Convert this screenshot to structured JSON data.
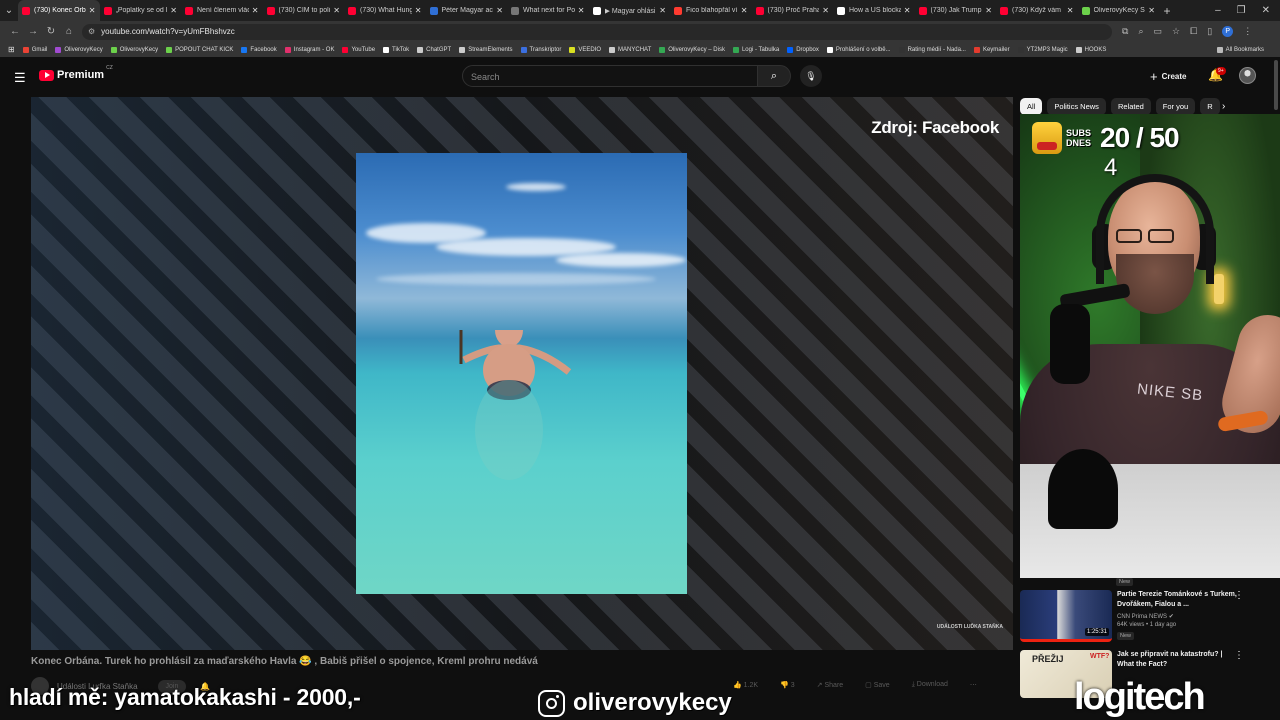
{
  "browser": {
    "tabs": [
      {
        "label": "(730) Konec Orbá",
        "color": "#ff0033",
        "active": true
      },
      {
        "label": "„Poplatky se od le",
        "color": "#ff0033",
        "active": false
      },
      {
        "label": "Není členem vlád",
        "color": "#ff0033",
        "active": false
      },
      {
        "label": "(730) ČÍM to poli",
        "color": "#ff0033",
        "active": false
      },
      {
        "label": "(730) What Hung",
        "color": "#ff0033",
        "active": false
      },
      {
        "label": "Péter Magyar ac",
        "color": "#2f6fd6",
        "active": false
      },
      {
        "label": "What next for Po",
        "color": "#777777",
        "active": false
      },
      {
        "label": "▶ Magyar ohlási",
        "color": "#ffffff",
        "active": false
      },
      {
        "label": "Fico blahopřál ví",
        "color": "#ff3b30",
        "active": false
      },
      {
        "label": "(730) Proč Praha",
        "color": "#ff0033",
        "active": false
      },
      {
        "label": "How a US blocka",
        "color": "#ffffff",
        "active": false
      },
      {
        "label": "(730) Jak Trump",
        "color": "#ff0033",
        "active": false
      },
      {
        "label": "(730) Když vám",
        "color": "#ff0033",
        "active": false
      },
      {
        "label": "OliverovyKecy St",
        "color": "#6cd14b",
        "active": false
      }
    ],
    "url": "youtube.com/watch?v=yUmFBhshvzc",
    "bookmarks": [
      {
        "label": "Gmail",
        "color": "#ea4335"
      },
      {
        "label": "OliverovyKecy",
        "color": "#a14bd1"
      },
      {
        "label": "OliverovyKecy",
        "color": "#6cd14b"
      },
      {
        "label": "POPOUT CHAT KICK",
        "color": "#6cd14b"
      },
      {
        "label": "Facebook",
        "color": "#1877f2"
      },
      {
        "label": "Instagram - OK",
        "color": "#e1306c"
      },
      {
        "label": "YouTube",
        "color": "#ff0033"
      },
      {
        "label": "TikTok",
        "color": "#ffffff"
      },
      {
        "label": "ChatGPT",
        "color": "#cccccc"
      },
      {
        "label": "StreamElements",
        "color": "#cccccc"
      },
      {
        "label": "Transkriptor",
        "color": "#3b6fe0"
      },
      {
        "label": "VEEDIO",
        "color": "#d9e021"
      },
      {
        "label": "MANYCHAT",
        "color": "#cccccc"
      },
      {
        "label": "OliverovyKecy – Disk",
        "color": "#34a853"
      },
      {
        "label": "Logi - Tabulka",
        "color": "#34a853"
      },
      {
        "label": "Dropbox",
        "color": "#0061ff"
      },
      {
        "label": "Prohlášení o volbě...",
        "color": "#ffffff"
      },
      {
        "label": "Rating médií - Nada...",
        "color": "#333333"
      },
      {
        "label": "Keymailer",
        "color": "#e33b2e"
      },
      {
        "label": "YT2MP3 Magic",
        "color": "#333333"
      },
      {
        "label": "HOOKS",
        "color": "#cccccc"
      }
    ],
    "all_bookmarks": "All Bookmarks"
  },
  "youtube": {
    "logo_text": "Premium",
    "country": "CZ",
    "search_placeholder": "Search",
    "create_label": "Create",
    "notif_count": "9+",
    "chips": [
      "All",
      "Politics News",
      "Related",
      "For you",
      "R"
    ]
  },
  "video": {
    "source_label": "Zdroj: Facebook",
    "watermark": "UDÁLOSTI LUĎKA STAŇKA",
    "title": "Konec Orbána. Turek ho prohlásil za maďarského Havla 😂 , Babiš přišel o spojence, Kreml prohru nedává",
    "channel": "Události Luďka Staňka",
    "join_label": "Join",
    "likes": "1.2K",
    "dislike_count": "3",
    "share": "Share",
    "save": "Save",
    "download": "Download"
  },
  "stream_overlay": {
    "subs_label_line1": "SUBS",
    "subs_label_line2": "DNES",
    "subs_count": "20 / 50",
    "subs_today": "4",
    "shirt_text": "NIKE SB",
    "donation": "hladí mě: yamatokakashi - 2000,-",
    "ig_handle": "oliverovykecy",
    "sponsor": "logitech"
  },
  "related": [
    {
      "title": "Partie Terezie Tománkové s Turkem, Dvořákem, Fialou a ...",
      "channel": "CNN Prima NEWS",
      "meta": "64K views • 1 day ago",
      "badge": "New",
      "duration": "1:25:31"
    },
    {
      "title": "Jak se připravit na katastrofu? | What the Fact?",
      "channel": "",
      "meta": "",
      "badge": "",
      "duration": "",
      "thumb_text_1": "PŘEŽIJ",
      "thumb_text_2": "WTF?"
    }
  ],
  "new_badge_top": "New"
}
